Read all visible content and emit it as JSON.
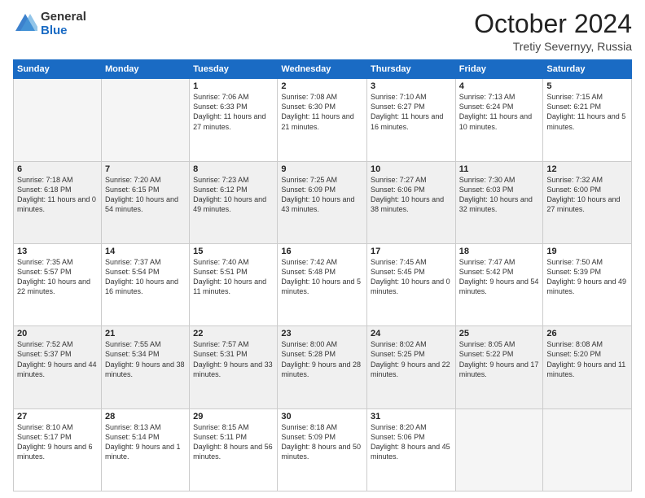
{
  "header": {
    "logo_line1": "General",
    "logo_line2": "Blue",
    "main_title": "October 2024",
    "subtitle": "Tretiy Severnyy, Russia"
  },
  "days_of_week": [
    "Sunday",
    "Monday",
    "Tuesday",
    "Wednesday",
    "Thursday",
    "Friday",
    "Saturday"
  ],
  "weeks": [
    [
      {
        "day": "",
        "sunrise": "",
        "sunset": "",
        "daylight": ""
      },
      {
        "day": "",
        "sunrise": "",
        "sunset": "",
        "daylight": ""
      },
      {
        "day": "1",
        "sunrise": "Sunrise: 7:06 AM",
        "sunset": "Sunset: 6:33 PM",
        "daylight": "Daylight: 11 hours and 27 minutes."
      },
      {
        "day": "2",
        "sunrise": "Sunrise: 7:08 AM",
        "sunset": "Sunset: 6:30 PM",
        "daylight": "Daylight: 11 hours and 21 minutes."
      },
      {
        "day": "3",
        "sunrise": "Sunrise: 7:10 AM",
        "sunset": "Sunset: 6:27 PM",
        "daylight": "Daylight: 11 hours and 16 minutes."
      },
      {
        "day": "4",
        "sunrise": "Sunrise: 7:13 AM",
        "sunset": "Sunset: 6:24 PM",
        "daylight": "Daylight: 11 hours and 10 minutes."
      },
      {
        "day": "5",
        "sunrise": "Sunrise: 7:15 AM",
        "sunset": "Sunset: 6:21 PM",
        "daylight": "Daylight: 11 hours and 5 minutes."
      }
    ],
    [
      {
        "day": "6",
        "sunrise": "Sunrise: 7:18 AM",
        "sunset": "Sunset: 6:18 PM",
        "daylight": "Daylight: 11 hours and 0 minutes."
      },
      {
        "day": "7",
        "sunrise": "Sunrise: 7:20 AM",
        "sunset": "Sunset: 6:15 PM",
        "daylight": "Daylight: 10 hours and 54 minutes."
      },
      {
        "day": "8",
        "sunrise": "Sunrise: 7:23 AM",
        "sunset": "Sunset: 6:12 PM",
        "daylight": "Daylight: 10 hours and 49 minutes."
      },
      {
        "day": "9",
        "sunrise": "Sunrise: 7:25 AM",
        "sunset": "Sunset: 6:09 PM",
        "daylight": "Daylight: 10 hours and 43 minutes."
      },
      {
        "day": "10",
        "sunrise": "Sunrise: 7:27 AM",
        "sunset": "Sunset: 6:06 PM",
        "daylight": "Daylight: 10 hours and 38 minutes."
      },
      {
        "day": "11",
        "sunrise": "Sunrise: 7:30 AM",
        "sunset": "Sunset: 6:03 PM",
        "daylight": "Daylight: 10 hours and 32 minutes."
      },
      {
        "day": "12",
        "sunrise": "Sunrise: 7:32 AM",
        "sunset": "Sunset: 6:00 PM",
        "daylight": "Daylight: 10 hours and 27 minutes."
      }
    ],
    [
      {
        "day": "13",
        "sunrise": "Sunrise: 7:35 AM",
        "sunset": "Sunset: 5:57 PM",
        "daylight": "Daylight: 10 hours and 22 minutes."
      },
      {
        "day": "14",
        "sunrise": "Sunrise: 7:37 AM",
        "sunset": "Sunset: 5:54 PM",
        "daylight": "Daylight: 10 hours and 16 minutes."
      },
      {
        "day": "15",
        "sunrise": "Sunrise: 7:40 AM",
        "sunset": "Sunset: 5:51 PM",
        "daylight": "Daylight: 10 hours and 11 minutes."
      },
      {
        "day": "16",
        "sunrise": "Sunrise: 7:42 AM",
        "sunset": "Sunset: 5:48 PM",
        "daylight": "Daylight: 10 hours and 5 minutes."
      },
      {
        "day": "17",
        "sunrise": "Sunrise: 7:45 AM",
        "sunset": "Sunset: 5:45 PM",
        "daylight": "Daylight: 10 hours and 0 minutes."
      },
      {
        "day": "18",
        "sunrise": "Sunrise: 7:47 AM",
        "sunset": "Sunset: 5:42 PM",
        "daylight": "Daylight: 9 hours and 54 minutes."
      },
      {
        "day": "19",
        "sunrise": "Sunrise: 7:50 AM",
        "sunset": "Sunset: 5:39 PM",
        "daylight": "Daylight: 9 hours and 49 minutes."
      }
    ],
    [
      {
        "day": "20",
        "sunrise": "Sunrise: 7:52 AM",
        "sunset": "Sunset: 5:37 PM",
        "daylight": "Daylight: 9 hours and 44 minutes."
      },
      {
        "day": "21",
        "sunrise": "Sunrise: 7:55 AM",
        "sunset": "Sunset: 5:34 PM",
        "daylight": "Daylight: 9 hours and 38 minutes."
      },
      {
        "day": "22",
        "sunrise": "Sunrise: 7:57 AM",
        "sunset": "Sunset: 5:31 PM",
        "daylight": "Daylight: 9 hours and 33 minutes."
      },
      {
        "day": "23",
        "sunrise": "Sunrise: 8:00 AM",
        "sunset": "Sunset: 5:28 PM",
        "daylight": "Daylight: 9 hours and 28 minutes."
      },
      {
        "day": "24",
        "sunrise": "Sunrise: 8:02 AM",
        "sunset": "Sunset: 5:25 PM",
        "daylight": "Daylight: 9 hours and 22 minutes."
      },
      {
        "day": "25",
        "sunrise": "Sunrise: 8:05 AM",
        "sunset": "Sunset: 5:22 PM",
        "daylight": "Daylight: 9 hours and 17 minutes."
      },
      {
        "day": "26",
        "sunrise": "Sunrise: 8:08 AM",
        "sunset": "Sunset: 5:20 PM",
        "daylight": "Daylight: 9 hours and 11 minutes."
      }
    ],
    [
      {
        "day": "27",
        "sunrise": "Sunrise: 8:10 AM",
        "sunset": "Sunset: 5:17 PM",
        "daylight": "Daylight: 9 hours and 6 minutes."
      },
      {
        "day": "28",
        "sunrise": "Sunrise: 8:13 AM",
        "sunset": "Sunset: 5:14 PM",
        "daylight": "Daylight: 9 hours and 1 minute."
      },
      {
        "day": "29",
        "sunrise": "Sunrise: 8:15 AM",
        "sunset": "Sunset: 5:11 PM",
        "daylight": "Daylight: 8 hours and 56 minutes."
      },
      {
        "day": "30",
        "sunrise": "Sunrise: 8:18 AM",
        "sunset": "Sunset: 5:09 PM",
        "daylight": "Daylight: 8 hours and 50 minutes."
      },
      {
        "day": "31",
        "sunrise": "Sunrise: 8:20 AM",
        "sunset": "Sunset: 5:06 PM",
        "daylight": "Daylight: 8 hours and 45 minutes."
      },
      {
        "day": "",
        "sunrise": "",
        "sunset": "",
        "daylight": ""
      },
      {
        "day": "",
        "sunrise": "",
        "sunset": "",
        "daylight": ""
      }
    ]
  ]
}
